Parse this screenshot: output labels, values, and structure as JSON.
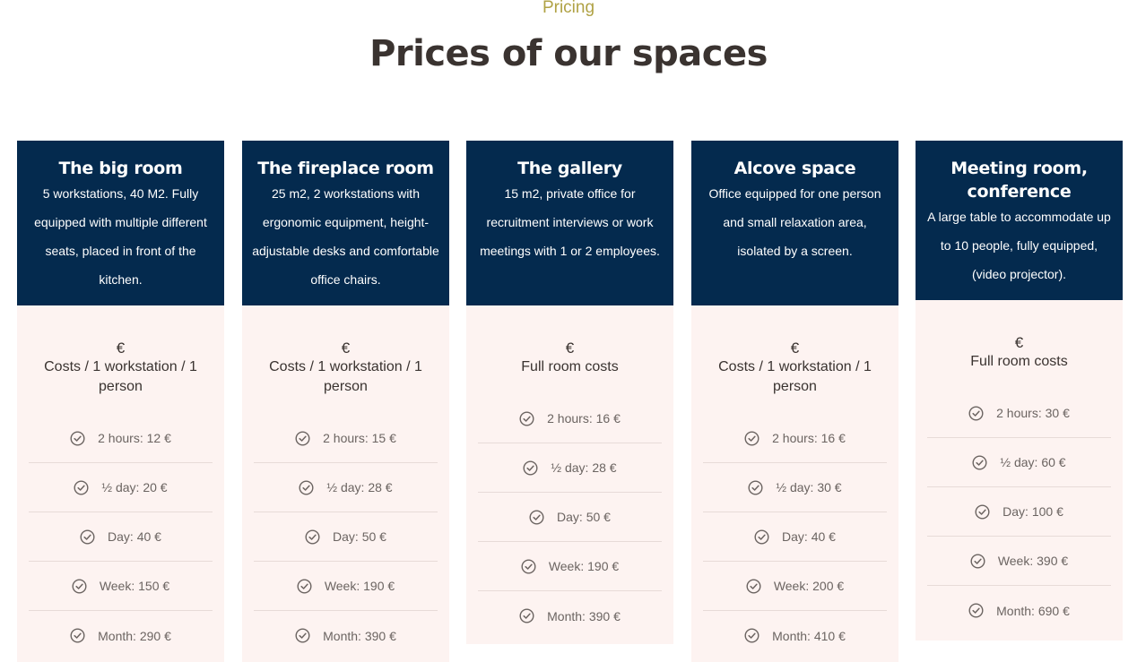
{
  "header": {
    "eyebrow": "Pricing",
    "title": "Prices of our spaces"
  },
  "colors": {
    "eyebrow": "#b0a245",
    "card_header": "#042a4e",
    "card_body": "#fdf3f1",
    "check_icon": "#6b6461"
  },
  "cards": [
    {
      "title": "The big room",
      "description": "5 workstations, 40 M2. Fully equipped with multiple different seats, placed in front of the kitchen.",
      "currency": "€",
      "unit": "Costs / 1 workstation / 1 person",
      "prices": [
        "2 hours: 12 €",
        "½ day: 20 €",
        "Day: 40 €",
        "Week: 150 €",
        "Month: 290 €"
      ]
    },
    {
      "title": "The fireplace room",
      "description": "25 m2, 2 workstations with ergonomic equipment, height-adjustable desks and comfortable office chairs.",
      "currency": "€",
      "unit": "Costs / 1 workstation / 1 person",
      "prices": [
        "2 hours: 15 €",
        "½ day: 28 €",
        "Day: 50 €",
        "Week: 190 €",
        "Month: 390 €"
      ]
    },
    {
      "title": "The gallery",
      "description": "15 m2, private office for recruitment interviews or work meetings with 1 or 2 employees.",
      "currency": "€",
      "unit": "Full room costs",
      "prices": [
        "2 hours: 16 €",
        "½ day: 28 €",
        "Day: 50 €",
        "Week: 190 €",
        "Month: 390 €"
      ]
    },
    {
      "title": "Alcove space",
      "description": "Office equipped for one person and small relaxation area, isolated by a screen.",
      "currency": "€",
      "unit": "Costs / 1 workstation / 1 person",
      "prices": [
        "2 hours: 16 €",
        "½ day: 30 €",
        "Day: 40 €",
        "Week: 200 €",
        "Month: 410 €"
      ]
    },
    {
      "title": "Meeting room, conference",
      "description": "A large table to accommodate up to 10 people, fully equipped, (video projector).",
      "currency": "€",
      "unit": "Full room costs",
      "prices": [
        "2 hours: 30 €",
        "½ day: 60 €",
        "Day: 100 €",
        "Week: 390 €",
        "Month: 690 €"
      ]
    }
  ]
}
